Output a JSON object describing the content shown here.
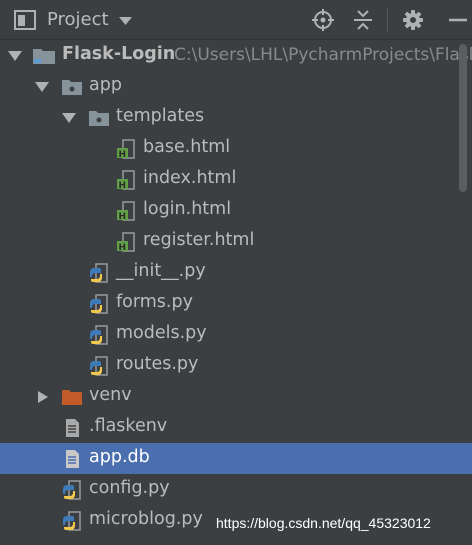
{
  "header": {
    "title": "Project",
    "icons": [
      "project-window-icon",
      "caret-down-icon",
      "locate-crosshair-icon",
      "collapse-all-icon",
      "gear-icon"
    ]
  },
  "tree": {
    "root": {
      "label": "Flask-Login",
      "path": "C:\\Users\\LHL\\PycharmProjects\\Flask"
    },
    "app": {
      "label": "app"
    },
    "templates": {
      "label": "templates"
    },
    "base_html": {
      "label": "base.html"
    },
    "index_html": {
      "label": "index.html"
    },
    "login_html": {
      "label": "login.html"
    },
    "register_html": {
      "label": "register.html"
    },
    "init_py": {
      "label": "__init__.py"
    },
    "forms_py": {
      "label": "forms.py"
    },
    "models_py": {
      "label": "models.py"
    },
    "routes_py": {
      "label": "routes.py"
    },
    "venv": {
      "label": "venv"
    },
    "flaskenv": {
      "label": ".flaskenv"
    },
    "app_db": {
      "label": "app.db"
    },
    "config_py": {
      "label": "config.py"
    },
    "microblog_py": {
      "label": "microblog.py"
    }
  },
  "selected_item": "app.db",
  "colors": {
    "panel_bg": "#3c3f41",
    "selection": "#4b6eaf",
    "text": "#bbbbbb",
    "path_text": "#8a8a8a",
    "venv_folder": "#c25a29",
    "html_icon": "#62a047"
  },
  "watermark": "https://blog.csdn.net/qq_45323012"
}
